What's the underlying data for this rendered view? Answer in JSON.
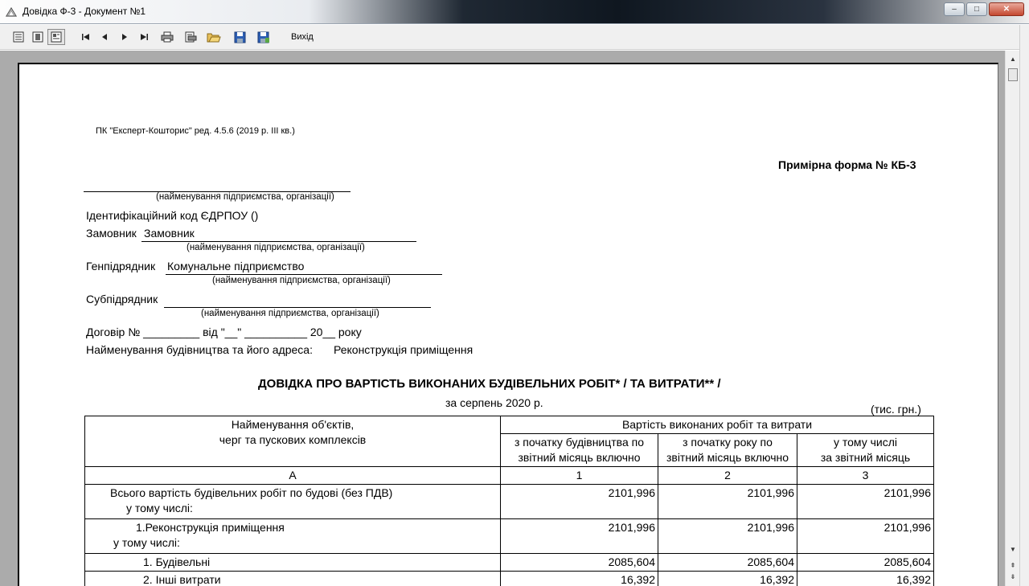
{
  "window": {
    "title": "Довідка Ф-3 - Документ №1",
    "buttons": {
      "minimize": "–",
      "maximize": "□",
      "close": "✕"
    }
  },
  "toolbar": {
    "icons": [
      "page-view-icon",
      "page-width-icon",
      "whole-page-icon",
      "first-page-icon",
      "prev-page-icon",
      "next-page-icon",
      "last-page-icon",
      "print-icon",
      "print-setup-icon",
      "open-icon",
      "save-icon",
      "save-as-icon"
    ],
    "exit_label": "Вихід"
  },
  "document": {
    "software": "ПК \"Експерт-Кошторис\" ред. 4.5.6 (2019 р. III кв.)",
    "form_name": "Примірна форма № КБ-3",
    "org_hint": "(найменування підприємства, організації)",
    "edrpou": "Ідентифікаційний код ЄДРПОУ ()",
    "customer_label": "Замовник",
    "customer_value": "Замовник",
    "contractor_label": "Генпідрядник",
    "contractor_value": "Комунальне підприємство",
    "subcontractor_label": "Субпідрядник",
    "contract_line": "Договір № _________ від \"__\" __________ 20__ року",
    "construction_label": "Найменування будівництва та його адреса:",
    "construction_value": "Реконструкція приміщення",
    "heading": "ДОВІДКА ПРО ВАРТІСТЬ ВИКОНАНИХ БУДІВЕЛЬНИХ РОБІТ* / ТА ВИТРАТИ** /",
    "period": "за серпень 2020 р.",
    "units": "(тис. грн.)"
  },
  "table": {
    "col_name_header_line1": "Найменування  об'єктів,",
    "col_name_header_line2": "черг та пускових комплексів",
    "cost_header": "Вартість виконаних робіт та витрати",
    "col1_line1": "з початку будівництва по",
    "col1_line2": "звітний місяць включно",
    "col2_line1": "з початку року по",
    "col2_line2": "звітний місяць включно",
    "col3_line1": "у тому числі",
    "col3_line2": "за звітний місяць",
    "index_row": [
      "А",
      "1",
      "2",
      "3"
    ],
    "rows": [
      {
        "line1": "Всього вартість будівельних робіт по будові (без ПДВ)",
        "line2": "у тому числі:",
        "v1": "2101,996",
        "v2": "2101,996",
        "v3": "2101,996"
      },
      {
        "line1": "1.Реконструкція приміщення",
        "line2": "у тому числі:",
        "v1": "2101,996",
        "v2": "2101,996",
        "v3": "2101,996"
      },
      {
        "line1": "1. Будівельні",
        "v1": "2085,604",
        "v2": "2085,604",
        "v3": "2085,604"
      },
      {
        "line1": "2. Інші витрати",
        "v1": "16,392",
        "v2": "16,392",
        "v3": "16,392"
      }
    ]
  }
}
